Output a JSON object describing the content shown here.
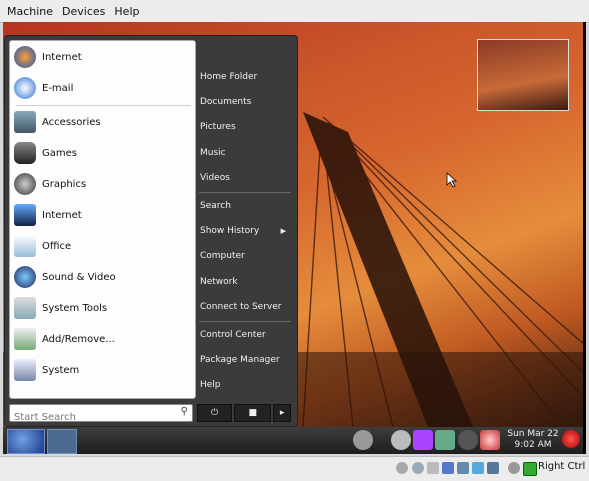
{
  "vm_menu": [
    "Machine",
    "Devices",
    "Help"
  ],
  "left_menu": {
    "pinned": [
      "Internet",
      "E-mail"
    ],
    "categories": [
      "Accessories",
      "Games",
      "Graphics",
      "Internet",
      "Office",
      "Sound & Video",
      "System Tools",
      "Add/Remove...",
      "System"
    ]
  },
  "search": {
    "placeholder": "Start Search"
  },
  "right_menu": {
    "group1": [
      "Home Folder",
      "Documents",
      "Pictures",
      "Music",
      "Videos"
    ],
    "group2": [
      "Search",
      "Show History",
      "Computer",
      "Network",
      "Connect to Server"
    ],
    "group3": [
      "Control Center",
      "Package Manager",
      "Help"
    ]
  },
  "clock": {
    "date": "Sun Mar 22",
    "time": "9:02 AM"
  },
  "status": {
    "host_key": "Right Ctrl"
  }
}
